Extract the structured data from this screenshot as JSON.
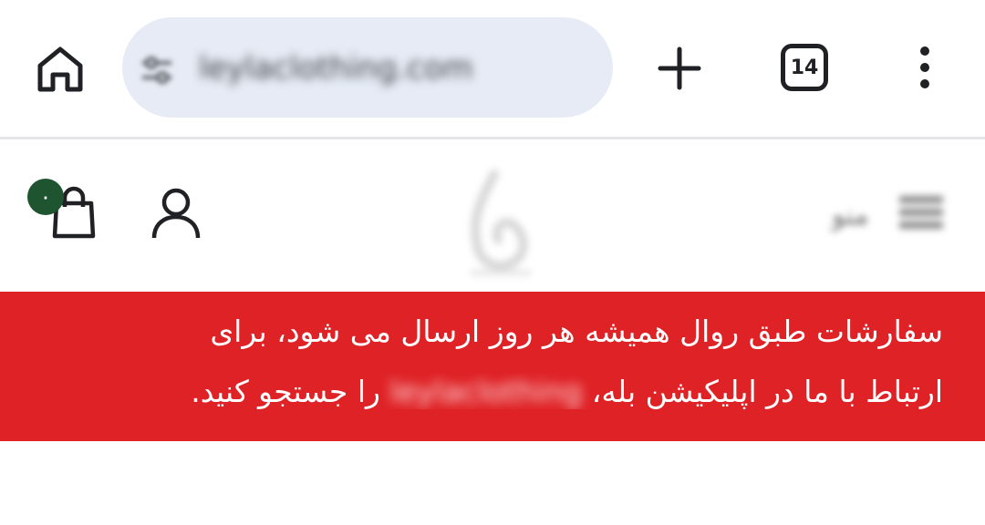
{
  "browser": {
    "url": "leylaclothing.com",
    "tab_count": "14",
    "icons": {
      "home": "home-icon",
      "site_info": "tune-icon",
      "new_tab": "plus-icon",
      "tabs": "tab-switcher-icon",
      "menu": "more-vertical-icon"
    }
  },
  "site": {
    "cart_count": "۰",
    "menu_label": "منو",
    "icons": {
      "cart": "shopping-bag-icon",
      "account": "user-icon",
      "logo": "brand-logo",
      "menu": "hamburger-icon"
    }
  },
  "announcement": {
    "line1": "سفارشات طبق روال همیشه هر روز ارسال می شود، برای",
    "line2_start": "ارتباط با ما در اپلیکیشن بله، ",
    "line2_blurred": "leylaclothing",
    "line2_end": " را جستجو کنید."
  },
  "colors": {
    "toolbar_bg": "#ffffff",
    "omnibox_bg": "#e6ebf5",
    "announcement_bg": "#df2226",
    "badge_bg": "#1e5530",
    "icon_color": "#202124"
  }
}
